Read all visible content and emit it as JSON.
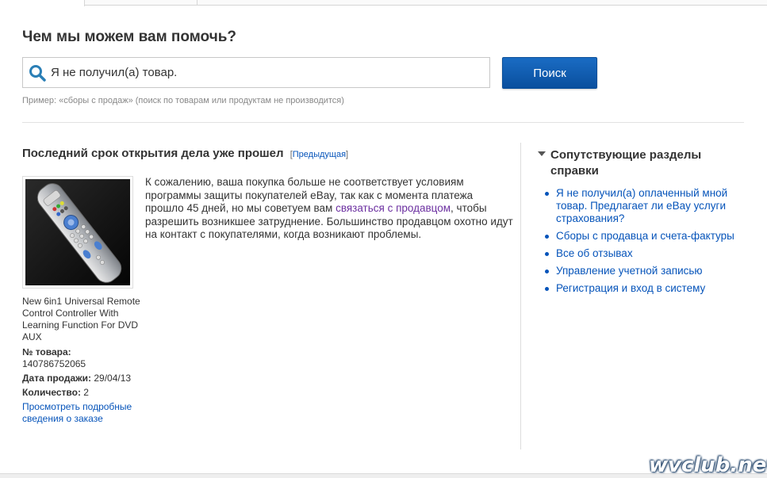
{
  "help": {
    "title": "Чем мы можем вам помочь?",
    "search_value": "Я не получил(а) товар.",
    "search_button": "Поиск",
    "hint": "Пример: «сборы с продаж» (поиск по товарам или продуктам не производится)"
  },
  "case": {
    "title": "Последний срок открытия дела уже прошел",
    "prev_open": "[",
    "prev_link": "Предыдущая",
    "prev_close": "]"
  },
  "product": {
    "name": "New 6in1 Universal Remote Control Controller With Learning Function For DVD AUX",
    "item_no_label": "№ товара:",
    "item_no": "140786752065",
    "sale_date_label": "Дата продажи:",
    "sale_date": "29/04/13",
    "qty_label": "Количество:",
    "qty": "2",
    "details_link": "Просмотреть подробные сведения о заказе"
  },
  "message": {
    "part1": "К сожалению, ваша покупка больше не соответствует условиям программы защиты покупателей eBay, так как с момента платежа прошло 45 дней, но мы советуем вам ",
    "link": "связаться с продавцом",
    "part2": ", чтобы разрешить возникшее затруднение. Большинство продавцом охотно идут на контакт с покупателями, когда возникают проблемы."
  },
  "related": {
    "title": "Сопутствующие разделы справки",
    "items": [
      "Я не получил(а) оплаченный мной товар. Предлагает ли eBay услуги страхования?",
      "Сборы с продавца и счета-фактуры",
      "Все об отзывах",
      "Управление учетной записью",
      "Регистрация и вход в систему"
    ]
  },
  "watermark": "wvclub.net",
  "colors": {
    "link": "#0654ba",
    "visited_link": "#6b2fa0",
    "button": "#0a4f9e"
  }
}
